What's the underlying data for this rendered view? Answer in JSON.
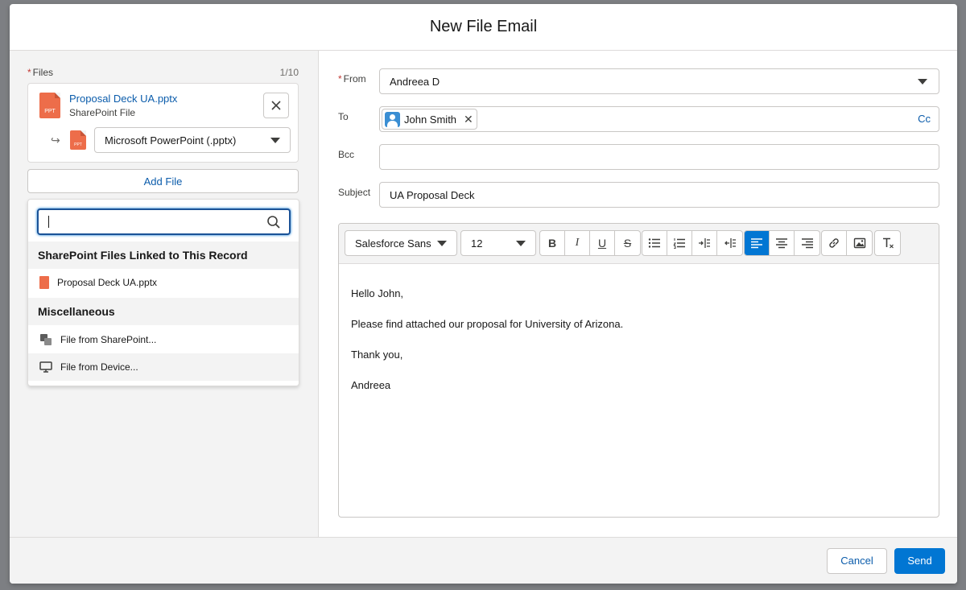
{
  "modal": {
    "title": "New File Email"
  },
  "files": {
    "label": "Files",
    "count": "1/10",
    "file": {
      "name": "Proposal Deck UA.pptx",
      "source": "SharePoint File",
      "icon_text": "PPT",
      "format": "Microsoft PowerPoint (.pptx)"
    },
    "add_file_label": "Add File"
  },
  "dropdown": {
    "search_value": "",
    "section1": "SharePoint Files Linked to This Record",
    "linked_files": [
      "Proposal Deck UA.pptx"
    ],
    "section2": "Miscellaneous",
    "misc_items": [
      "File from SharePoint...",
      "File from Device..."
    ]
  },
  "form": {
    "from_label": "From",
    "from_value": "Andreea D",
    "to_label": "To",
    "to_recipient": "John Smith",
    "cc_label": "Cc",
    "bcc_label": "Bcc",
    "subject_label": "Subject",
    "subject_value": "UA Proposal Deck"
  },
  "editor": {
    "font": "Salesforce Sans",
    "size": "12",
    "body": [
      "Hello John,",
      "Please find attached our proposal for University of Arizona.",
      "Thank you,",
      "Andreea"
    ]
  },
  "footer": {
    "cancel": "Cancel",
    "send": "Send"
  },
  "colors": {
    "brand": "#0176d3",
    "link": "#0b5cab",
    "ppt": "#ed6d4a",
    "required": "#c23934"
  }
}
